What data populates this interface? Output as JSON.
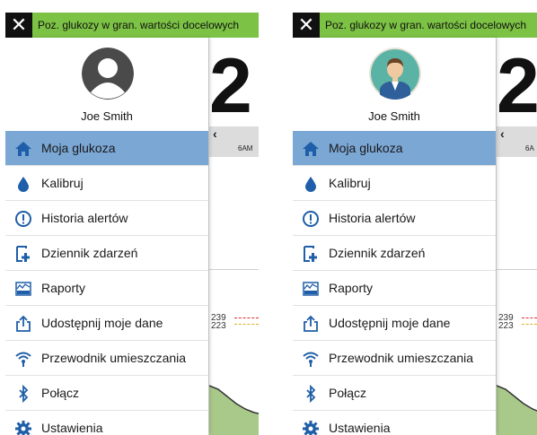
{
  "screens": [
    {
      "alert": {
        "close_icon": "close-icon",
        "text": "Poz. glukozy w gran. wartości docelowych"
      },
      "background": {
        "big_value": "2",
        "time_label": "6AM",
        "target_high": "239",
        "target_low": "223"
      },
      "profile": {
        "avatar": "default-silhouette",
        "name": "Joe Smith"
      },
      "menu": [
        {
          "label": "Moja glukoza",
          "icon": "home-icon",
          "active": true
        },
        {
          "label": "Kalibruj",
          "icon": "blood-drop-icon"
        },
        {
          "label": "Historia alertów",
          "icon": "alert-circle-icon"
        },
        {
          "label": "Dziennik zdarzeń",
          "icon": "event-log-icon"
        },
        {
          "label": "Raporty",
          "icon": "reports-icon"
        },
        {
          "label": "Udostępnij moje dane",
          "icon": "share-icon"
        },
        {
          "label": "Przewodnik umieszczania",
          "icon": "wifi-signal-icon"
        },
        {
          "label": "Połącz",
          "icon": "bluetooth-icon"
        },
        {
          "label": "Ustawienia",
          "icon": "settings-gear-icon"
        }
      ]
    },
    {
      "alert": {
        "close_icon": "close-icon",
        "text": "Poz. glukozy w gran. wartości docelowych"
      },
      "background": {
        "big_value": "2",
        "time_label": "6A",
        "target_high": "239",
        "target_low": "223"
      },
      "profile": {
        "avatar": "photo-man-cartoon",
        "name": "Joe Smith"
      },
      "menu": [
        {
          "label": "Moja glukoza",
          "icon": "home-icon",
          "active": true
        },
        {
          "label": "Kalibruj",
          "icon": "blood-drop-icon"
        },
        {
          "label": "Historia alertów",
          "icon": "alert-circle-icon"
        },
        {
          "label": "Dziennik zdarzeń",
          "icon": "event-log-icon"
        },
        {
          "label": "Raporty",
          "icon": "reports-icon"
        },
        {
          "label": "Udostępnij moje dane",
          "icon": "share-icon"
        },
        {
          "label": "Przewodnik umieszczania",
          "icon": "wifi-signal-icon"
        },
        {
          "label": "Połącz",
          "icon": "bluetooth-icon"
        },
        {
          "label": "Ustawienia",
          "icon": "settings-gear-icon"
        }
      ]
    }
  ],
  "colors": {
    "alert_green": "#7cc244",
    "active_blue": "#7ba7d5",
    "icon_blue": "#1f5ea8"
  }
}
